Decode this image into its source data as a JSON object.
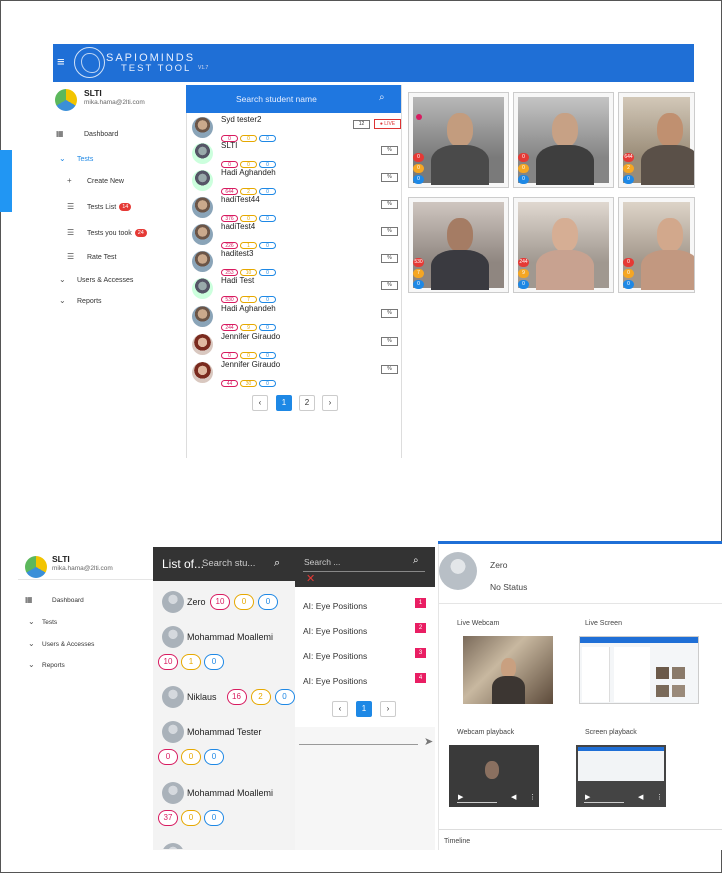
{
  "top": {
    "brand_line1": "SAPIOMINDS",
    "brand_line2": "TEST TOOL",
    "version": "V1.7",
    "user": {
      "name": "SLTI",
      "email": "mika.hama@2lti.com"
    },
    "nav": {
      "dashboard": "Dashboard",
      "tests": "Tests",
      "create_new": "Create New",
      "tests_list": "Tests List",
      "tests_list_count": "14",
      "tests_you_took": "Tests you took",
      "tests_you_took_count": "24",
      "rate_test": "Rate Test",
      "users": "Users & Accesses",
      "reports": "Reports"
    },
    "search_placeholder": "Search student name",
    "students": [
      {
        "name": "Syd tester2",
        "a": "0",
        "b": "0",
        "c": "0",
        "mini": "12",
        "live": "● LIVE",
        "avatar": "male"
      },
      {
        "name": "SLTI",
        "a": "0",
        "b": "0",
        "c": "0",
        "mini": "%",
        "avatar": "anon"
      },
      {
        "name": "Hadi Aghandeh",
        "a": "644",
        "b": "2",
        "c": "0",
        "mini": "%",
        "avatar": "anon"
      },
      {
        "name": "hadiTest44",
        "a": "376",
        "b": "0",
        "c": "0",
        "mini": "%",
        "avatar": "male"
      },
      {
        "name": "hadiTest4",
        "a": "226",
        "b": "1",
        "c": "0",
        "mini": "%",
        "avatar": "male"
      },
      {
        "name": "haditest3",
        "a": "253",
        "b": "10",
        "c": "0",
        "mini": "%",
        "avatar": "male"
      },
      {
        "name": "Hadi Test",
        "a": "530",
        "b": "7",
        "c": "0",
        "mini": "%",
        "avatar": "anon"
      },
      {
        "name": "Hadi Aghandeh",
        "a": "244",
        "b": "9",
        "c": "0",
        "mini": "%",
        "avatar": "male"
      },
      {
        "name": "Jennifer Giraudo",
        "a": "0",
        "b": "0",
        "c": "0",
        "mini": "%",
        "avatar": "female"
      },
      {
        "name": "Jennifer Giraudo",
        "a": "44",
        "b": "30",
        "c": "0",
        "mini": "%",
        "avatar": "female"
      }
    ],
    "pager": {
      "prev": "‹",
      "p1": "1",
      "p2": "2",
      "next": "›"
    },
    "cams": [
      {
        "a": "0",
        "b": "0",
        "c": "0"
      },
      {
        "a": "0",
        "b": "0",
        "c": "0"
      },
      {
        "a": "644",
        "b": "2",
        "c": "0"
      },
      {
        "a": "530",
        "b": "7",
        "c": "0"
      },
      {
        "a": "244",
        "b": "9",
        "c": "0"
      },
      {
        "a": "0",
        "b": "0",
        "c": "0"
      }
    ]
  },
  "bottom": {
    "user": {
      "name": "SLTI",
      "email": "mika.hama@2lti.com"
    },
    "nav": {
      "dashboard": "Dashboard",
      "tests": "Tests",
      "users": "Users & Accesses",
      "reports": "Reports"
    },
    "list_title": "List of...",
    "search_student": "Search stu...",
    "students": [
      {
        "name": "Zero",
        "a": "10",
        "b": "0",
        "c": "0"
      },
      {
        "name": "Mohammad Moallemi",
        "a": "10",
        "b": "1",
        "c": "0"
      },
      {
        "name": "Niklaus",
        "a": "16",
        "b": "2",
        "c": "0"
      },
      {
        "name": "Mohammad Tester",
        "a": "0",
        "b": "0",
        "c": "0"
      },
      {
        "name": "Mohammad Moallemi",
        "a": "37",
        "b": "0",
        "c": "0"
      }
    ],
    "search_events": "Search ...",
    "clear": "✕",
    "events": [
      {
        "label": "AI: Eye Positions",
        "num": "1"
      },
      {
        "label": "AI: Eye Positions",
        "num": "2"
      },
      {
        "label": "AI: Eye Positions",
        "num": "3"
      },
      {
        "label": "AI: Eye Positions",
        "num": "4"
      }
    ],
    "pager": {
      "prev": "‹",
      "p1": "1",
      "next": "›"
    },
    "send": "➤",
    "detail": {
      "name": "Zero",
      "status": "No Status",
      "live_webcam": "Live Webcam",
      "live_screen": "Live Screen",
      "webcam_playback": "Webcam playback",
      "screen_playback": "Screen playback",
      "timeline": "Timeline"
    }
  }
}
